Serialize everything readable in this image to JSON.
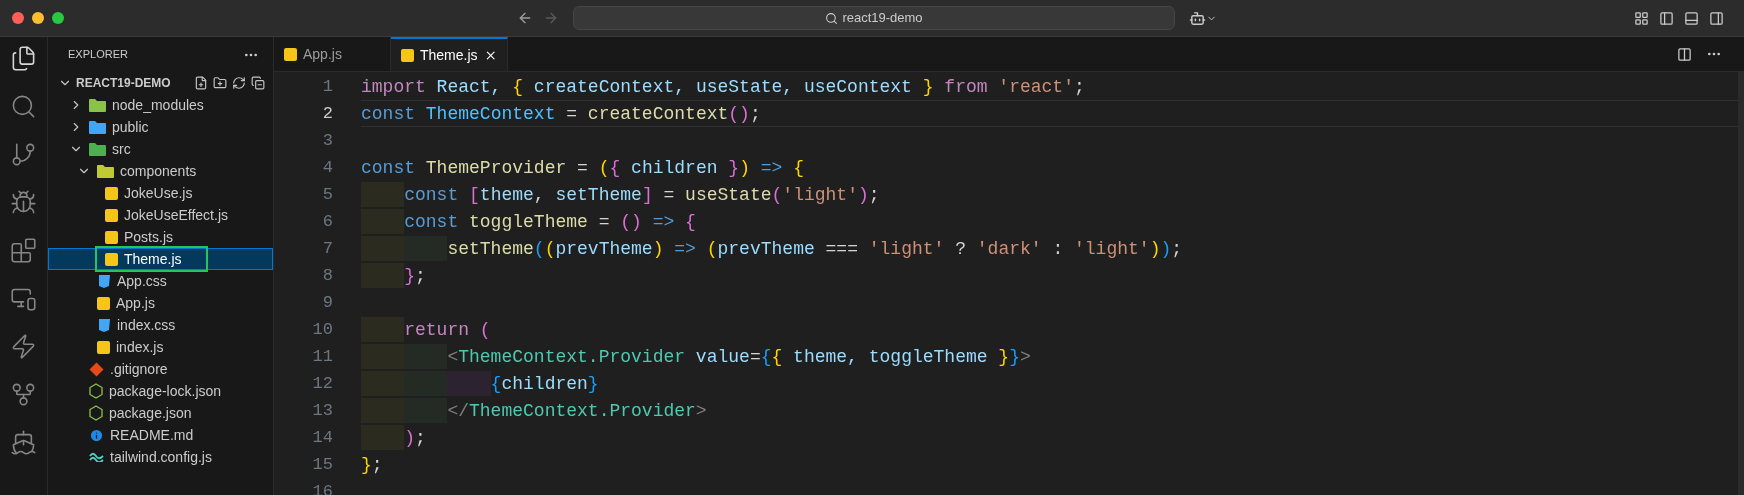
{
  "window": {
    "search": "react19-demo"
  },
  "explorer": {
    "title": "EXPLORER",
    "project": {
      "name": "REACT19-DEMO",
      "expanded": true
    },
    "items": [
      {
        "name": "node_modules",
        "kind": "folder",
        "color": "#8bc34a",
        "expanded": false,
        "selected": false
      },
      {
        "name": "public",
        "kind": "folder",
        "color": "#42a5f5",
        "expanded": false,
        "selected": false
      },
      {
        "name": "src",
        "kind": "folder",
        "color": "#4caf50",
        "expanded": true,
        "selected": false,
        "children": [
          {
            "name": "components",
            "kind": "folder",
            "color": "#c0ca33",
            "expanded": true,
            "selected": false,
            "children": [
              {
                "name": "JokeUse.js",
                "kind": "js",
                "selected": false
              },
              {
                "name": "JokeUseEffect.js",
                "kind": "js",
                "selected": false
              },
              {
                "name": "Posts.js",
                "kind": "js",
                "selected": false
              },
              {
                "name": "Theme.js",
                "kind": "js",
                "selected": true
              }
            ]
          },
          {
            "name": "App.css",
            "kind": "css",
            "selected": false
          },
          {
            "name": "App.js",
            "kind": "js",
            "selected": false
          },
          {
            "name": "index.css",
            "kind": "css",
            "selected": false
          },
          {
            "name": "index.js",
            "kind": "js",
            "selected": false
          }
        ]
      },
      {
        "name": ".gitignore",
        "kind": "git",
        "selected": false
      },
      {
        "name": "package-lock.json",
        "kind": "json",
        "selected": false
      },
      {
        "name": "package.json",
        "kind": "json",
        "selected": false
      },
      {
        "name": "README.md",
        "kind": "info",
        "selected": false
      },
      {
        "name": "tailwind.config.js",
        "kind": "tailwind",
        "selected": false
      }
    ]
  },
  "tabs": [
    {
      "label": "App.js",
      "selected": false
    },
    {
      "label": "Theme.js",
      "selected": true
    }
  ],
  "editor": {
    "lines": [
      {
        "number": "1",
        "current": false,
        "tokens": [
          {
            "text": "import",
            "kind": "kw"
          },
          {
            "text": " React, ",
            "kind": "var"
          },
          {
            "text": "{",
            "kind": "b1"
          },
          {
            "text": " createContext, useState, useContext ",
            "kind": "var"
          },
          {
            "text": "}",
            "kind": "b1"
          },
          {
            "text": " from",
            "kind": "kw"
          },
          {
            "text": " 'react'",
            "kind": "str"
          },
          {
            "text": ";",
            "kind": "plain"
          }
        ]
      },
      {
        "number": "2",
        "current": true,
        "tokens": [
          {
            "text": "const",
            "kind": "storage"
          },
          {
            "text": " ThemeContext",
            "kind": "const"
          },
          {
            "text": " = ",
            "kind": "plain"
          },
          {
            "text": "createContext",
            "kind": "fn"
          },
          {
            "text": "()",
            "kind": "b2"
          },
          {
            "text": ";",
            "kind": "plain"
          }
        ]
      },
      {
        "number": "3",
        "current": false
      },
      {
        "number": "4",
        "current": false,
        "tokens": [
          {
            "text": "const",
            "kind": "storage"
          },
          {
            "text": " ThemeProvider",
            "kind": "fn"
          },
          {
            "text": " = ",
            "kind": "plain"
          },
          {
            "text": "(",
            "kind": "b1"
          },
          {
            "text": "{",
            "kind": "b2"
          },
          {
            "text": " children ",
            "kind": "var"
          },
          {
            "text": "}",
            "kind": "b2"
          },
          {
            "text": ")",
            "kind": "b1"
          },
          {
            "text": " => ",
            "kind": "storage"
          },
          {
            "text": "{",
            "kind": "b1"
          }
        ]
      },
      {
        "number": "5",
        "current": false,
        "tokens": [
          {
            "kind": "indent"
          },
          {
            "text": "const",
            "kind": "storage"
          },
          {
            "text": " [",
            "kind": "b2"
          },
          {
            "text": "theme",
            "kind": "var"
          },
          {
            "text": ", ",
            "kind": "plain"
          },
          {
            "text": "setTheme",
            "kind": "var"
          },
          {
            "text": "]",
            "kind": "b2"
          },
          {
            "text": " = ",
            "kind": "plain"
          },
          {
            "text": "useState",
            "kind": "fn"
          },
          {
            "text": "(",
            "kind": "b2"
          },
          {
            "text": "'light'",
            "kind": "str"
          },
          {
            "text": ")",
            "kind": "b2"
          },
          {
            "text": ";",
            "kind": "plain"
          }
        ]
      },
      {
        "number": "6",
        "current": false,
        "tokens": [
          {
            "kind": "indent"
          },
          {
            "text": "const",
            "kind": "storage"
          },
          {
            "text": " toggleTheme",
            "kind": "fn"
          },
          {
            "text": " = ",
            "kind": "plain"
          },
          {
            "text": "()",
            "kind": "b2"
          },
          {
            "text": " => ",
            "kind": "storage"
          },
          {
            "text": "{",
            "kind": "b2"
          }
        ]
      },
      {
        "number": "7",
        "current": false,
        "tokens": [
          {
            "kind": "indent"
          },
          {
            "kind": "indent"
          },
          {
            "text": "setTheme",
            "kind": "fn"
          },
          {
            "text": "(",
            "kind": "b3"
          },
          {
            "text": "(",
            "kind": "b1"
          },
          {
            "text": "prevTheme",
            "kind": "var"
          },
          {
            "text": ")",
            "kind": "b1"
          },
          {
            "text": " => ",
            "kind": "storage"
          },
          {
            "text": "(",
            "kind": "b1"
          },
          {
            "text": "prevTheme",
            "kind": "var"
          },
          {
            "text": " === ",
            "kind": "plain"
          },
          {
            "text": "'light'",
            "kind": "str"
          },
          {
            "text": " ? ",
            "kind": "plain"
          },
          {
            "text": "'dark'",
            "kind": "str"
          },
          {
            "text": " : ",
            "kind": "plain"
          },
          {
            "text": "'light'",
            "kind": "str"
          },
          {
            "text": ")",
            "kind": "b1"
          },
          {
            "text": ")",
            "kind": "b3"
          },
          {
            "text": ";",
            "kind": "plain"
          }
        ]
      },
      {
        "number": "8",
        "current": false,
        "tokens": [
          {
            "kind": "indent"
          },
          {
            "text": "}",
            "kind": "b2"
          },
          {
            "text": ";",
            "kind": "plain"
          }
        ]
      },
      {
        "number": "9",
        "current": false
      },
      {
        "number": "10",
        "current": false,
        "tokens": [
          {
            "kind": "indent"
          },
          {
            "text": "return",
            "kind": "kw"
          },
          {
            "text": " (",
            "kind": "b2"
          }
        ]
      },
      {
        "number": "11",
        "current": false,
        "tokens": [
          {
            "kind": "indent"
          },
          {
            "kind": "indent"
          },
          {
            "text": "<",
            "kind": "tagp"
          },
          {
            "text": "ThemeContext.Provider",
            "kind": "tag"
          },
          {
            "text": " value",
            "kind": "attr"
          },
          {
            "text": "=",
            "kind": "plain"
          },
          {
            "text": "{",
            "kind": "b3"
          },
          {
            "text": "{",
            "kind": "b1"
          },
          {
            "text": " theme, toggleTheme ",
            "kind": "var"
          },
          {
            "text": "}",
            "kind": "b1"
          },
          {
            "text": "}",
            "kind": "b3"
          },
          {
            "text": ">",
            "kind": "tagp"
          }
        ]
      },
      {
        "number": "12",
        "current": false,
        "tokens": [
          {
            "kind": "indent"
          },
          {
            "kind": "indent"
          },
          {
            "kind": "indent"
          },
          {
            "text": "{",
            "kind": "b3"
          },
          {
            "text": "children",
            "kind": "var"
          },
          {
            "text": "}",
            "kind": "b3"
          }
        ]
      },
      {
        "number": "13",
        "current": false,
        "tokens": [
          {
            "kind": "indent"
          },
          {
            "kind": "indent"
          },
          {
            "text": "</",
            "kind": "tagp"
          },
          {
            "text": "ThemeContext.Provider",
            "kind": "tag"
          },
          {
            "text": ">",
            "kind": "tagp"
          }
        ]
      },
      {
        "number": "14",
        "current": false,
        "tokens": [
          {
            "kind": "indent"
          },
          {
            "text": ")",
            "kind": "b2"
          },
          {
            "text": ";",
            "kind": "plain"
          }
        ]
      },
      {
        "number": "15",
        "current": false,
        "tokens": [
          {
            "text": "}",
            "kind": "b1"
          },
          {
            "text": ";",
            "kind": "plain"
          }
        ]
      },
      {
        "number": "16",
        "current": false
      }
    ]
  }
}
